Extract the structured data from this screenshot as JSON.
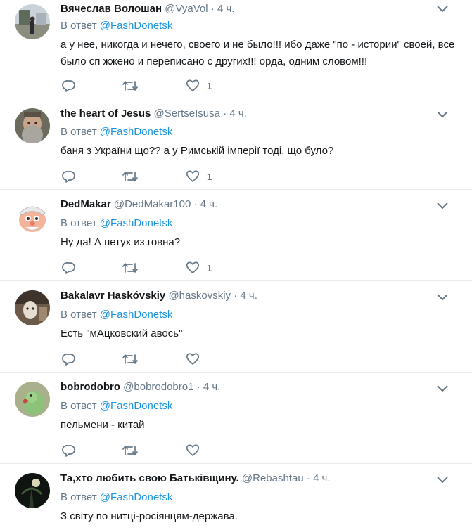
{
  "reply_prefix": "В ответ",
  "colors": {
    "link": "#1b95e0",
    "muted": "#657786",
    "text": "#14171a",
    "border": "#e6ecf0"
  },
  "icons": {
    "reply": "reply-icon",
    "retweet": "retweet-icon",
    "like": "heart-icon",
    "menu": "chevron-down-icon"
  },
  "tweets": [
    {
      "name": "Вячеслав Волошан",
      "handle": "@VyaVol",
      "dot": "·",
      "time": "4 ч.",
      "reply_to": "@FashDonetsk",
      "text": "а у нее, никогда и нечего, своего и не было!!! ибо даже \"по - истории\" своей, все было сп  жжено и переписано с других!!! орда, одним словом!!!",
      "likes": "1"
    },
    {
      "name": "the heart of Jesus",
      "handle": "@SertseIsusa",
      "dot": "·",
      "time": "4 ч.",
      "reply_to": "@FashDonetsk",
      "text": "баня з України що?? а у Римській імперії тоді, що було?",
      "likes": "1"
    },
    {
      "name": "DedMakar",
      "handle": "@DedMakar100",
      "dot": "·",
      "time": "4 ч.",
      "reply_to": "@FashDonetsk",
      "text": "Ну да! А петух из говна?",
      "likes": "1"
    },
    {
      "name": "Bakalavr Haskóvskiy",
      "handle": "@haskovskiy",
      "dot": "·",
      "time": "4 ч.",
      "reply_to": "@FashDonetsk",
      "text": "Есть \"мАцковский авось\"",
      "likes": ""
    },
    {
      "name": "bobrodobro",
      "handle": "@bobrodobro1",
      "dot": "·",
      "time": "4 ч.",
      "reply_to": "@FashDonetsk",
      "text": "пельмени - китай",
      "likes": ""
    },
    {
      "name": "Та,хто любить свою Батьківщину.",
      "handle": "@Rebashtau",
      "dot": "·",
      "time": "4 ч.",
      "reply_to": "@FashDonetsk",
      "text": "З світу по нитці-росіянцям-держава.",
      "likes": ""
    }
  ]
}
